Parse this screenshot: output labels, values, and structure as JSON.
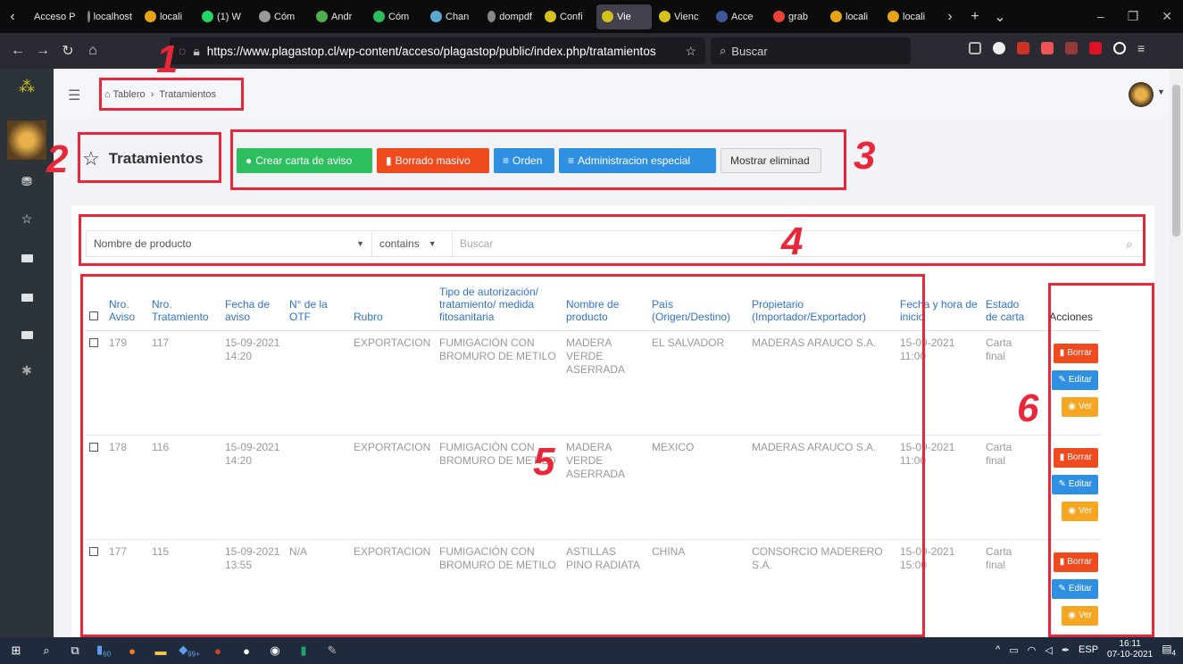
{
  "browser": {
    "tabs": [
      {
        "label": "Acceso P",
        "color": "#888"
      },
      {
        "label": "localhost",
        "color": "#888"
      },
      {
        "label": "locali",
        "color": "#e8a317"
      },
      {
        "label": "(1) W",
        "color": "#25d366"
      },
      {
        "label": "Cóm",
        "color": "#999"
      },
      {
        "label": "Andr",
        "color": "#4caf50"
      },
      {
        "label": "Cóm",
        "color": "#2dbe60"
      },
      {
        "label": "Chan",
        "color": "#5fa8d3"
      },
      {
        "label": "dompdf",
        "color": "#888"
      },
      {
        "label": "Confi",
        "color": "#d4c21a"
      },
      {
        "label": "Vie",
        "color": "#d4c21a",
        "active": true
      },
      {
        "label": "Vienc",
        "color": "#d4c21a"
      },
      {
        "label": "Acce",
        "color": "#3b5998"
      },
      {
        "label": "grab",
        "color": "#ea4335"
      },
      {
        "label": "locali",
        "color": "#e8a317"
      },
      {
        "label": "locali",
        "color": "#e8a317"
      }
    ],
    "url": "https://www.plagastop.cl/wp-content/acceso/plagastop/public/index.php/tratamientos",
    "search_placeholder": "Buscar"
  },
  "breadcrumb": {
    "home": "Tablero",
    "current": "Tratamientos"
  },
  "page_title": "Tratamientos",
  "actions": {
    "create": "Crear carta de aviso",
    "bulk_delete": "Borrado masivo",
    "order": "Orden",
    "special": "Administracion especial",
    "show_deleted": "Mostrar eliminad"
  },
  "filter": {
    "field": "Nombre de producto",
    "operator": "contains",
    "placeholder": "Buscar"
  },
  "table": {
    "headers": [
      "Nro. Aviso",
      "Nro. Tratamiento",
      "Fecha de aviso",
      "N° de la OTF",
      "Rubro",
      "Tipo de autorización/ tratamiento/ medida fitosanitaria",
      "Nombre de producto",
      "País (Origen/Destino)",
      "Propietario (Importador/Exportador)",
      "Fecha y hora de inicio",
      "Estado de carta",
      "Acciones"
    ],
    "rows": [
      {
        "aviso": "179",
        "tratamiento": "117",
        "fecha": "15-09-2021 14:20",
        "otf": "",
        "rubro": "EXPORTACION",
        "tipo": "FUMIGACIÓN CON BROMURO DE METILO",
        "producto": "MADERA VERDE ASERRADA",
        "pais": "EL SALVADOR",
        "propietario": "MADERAS ARAUCO S.A.",
        "inicio": "15-09-2021 11:00",
        "estado": "Carta final"
      },
      {
        "aviso": "178",
        "tratamiento": "116",
        "fecha": "15-09-2021 14:20",
        "otf": "",
        "rubro": "EXPORTACION",
        "tipo": "FUMIGACIÓN CON BROMURO DE METILO",
        "producto": "MADERA VERDE ASERRADA",
        "pais": "MEXICO",
        "propietario": "MADERAS ARAUCO S.A.",
        "inicio": "15-09-2021 11:00",
        "estado": "Carta final"
      },
      {
        "aviso": "177",
        "tratamiento": "115",
        "fecha": "15-09-2021 13:55",
        "otf": "N/A",
        "rubro": "EXPORTACION",
        "tipo": "FUMIGACIÓN CON BROMURO DE METILO",
        "producto": "ASTILLAS PINO RADIATA",
        "pais": "CHINA",
        "propietario": "CONSORCIO MADERERO S.A.",
        "inicio": "15-09-2021 15:00",
        "estado": "Carta final"
      }
    ],
    "row_actions": {
      "delete": "Borrar",
      "edit": "Editar",
      "view": "Ver"
    }
  },
  "annotations": [
    "1",
    "2",
    "3",
    "4",
    "5",
    "6"
  ],
  "taskbar": {
    "badge_a": "60",
    "badge_b": "99+",
    "lang": "ESP",
    "time": "16:11",
    "date": "07-10-2021",
    "notif": "4"
  },
  "colors": {
    "annotation": "#e8283a",
    "green": "#2dbe60",
    "red": "#f04a1f",
    "blue": "#2f8fe0",
    "orange": "#f5a623"
  }
}
